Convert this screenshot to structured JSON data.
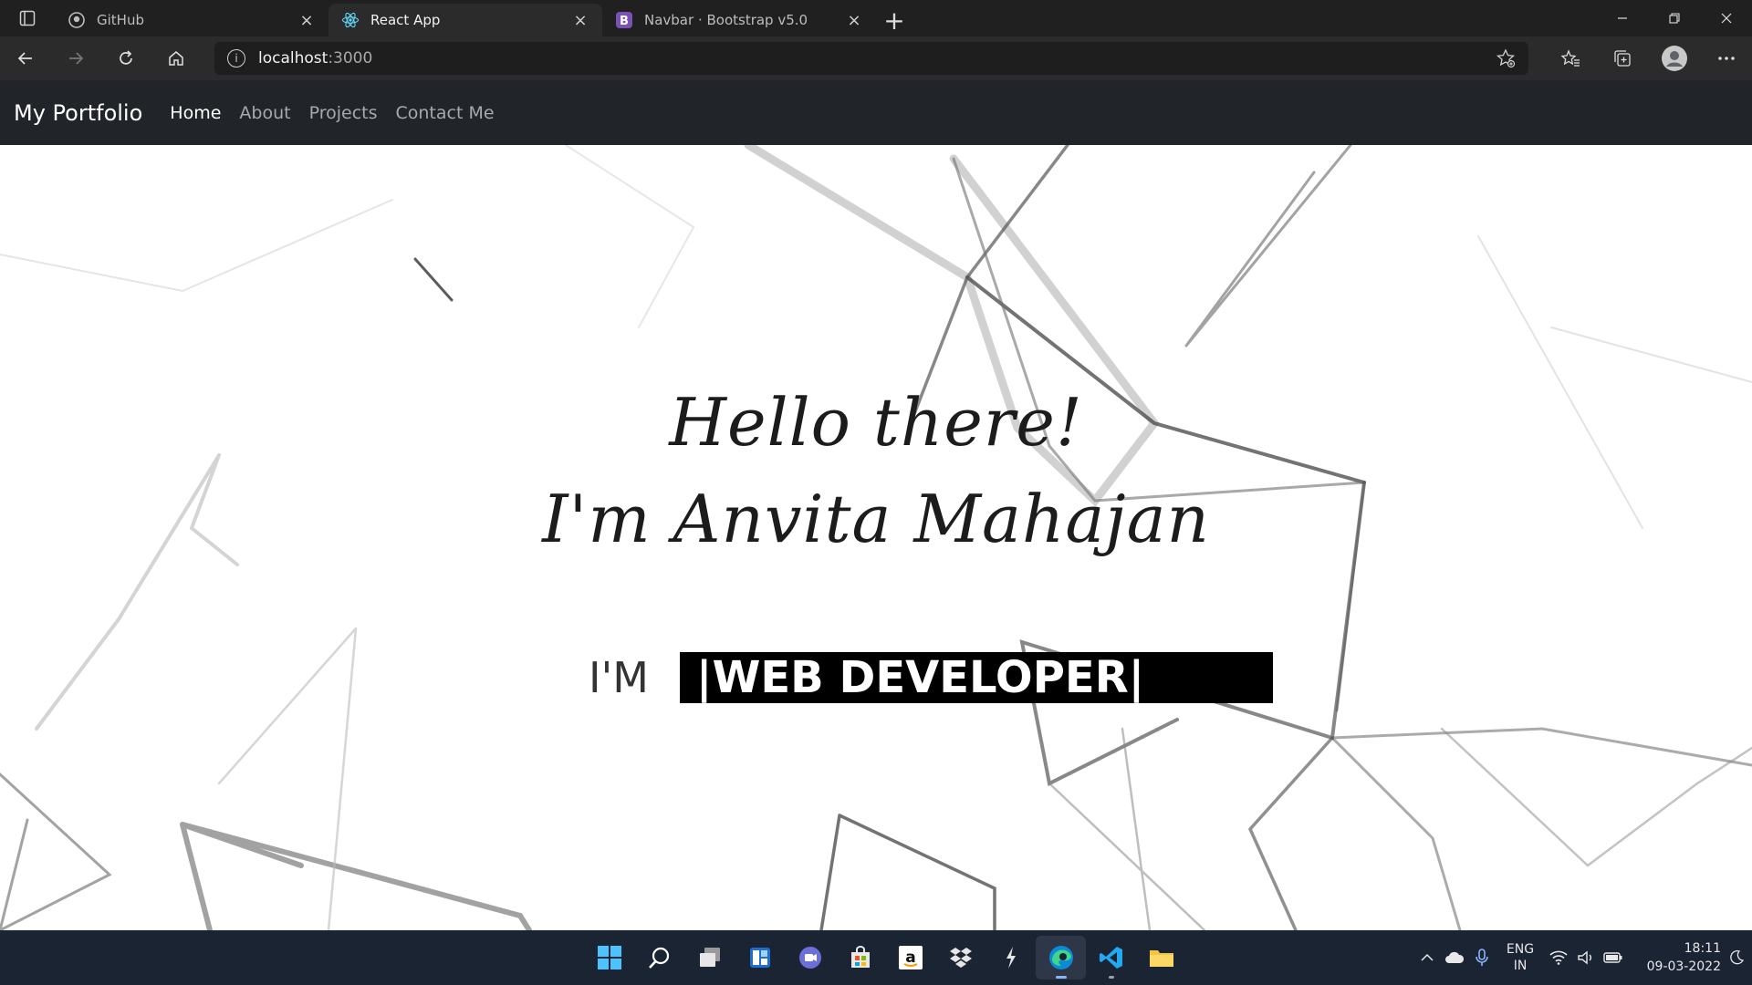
{
  "browser": {
    "tabs": [
      {
        "title": "GitHub",
        "icon": "github-icon",
        "active": false
      },
      {
        "title": "React App",
        "icon": "react-icon",
        "active": true
      },
      {
        "title": "Navbar · Bootstrap v5.0",
        "icon": "bootstrap-icon",
        "active": false
      }
    ],
    "url_host": "localhost",
    "url_port": ":3000"
  },
  "site": {
    "brand": "My Portfolio",
    "nav": [
      "Home",
      "About",
      "Projects",
      "Contact Me"
    ],
    "active_nav": "Home",
    "hero": {
      "line1": "Hello there!",
      "line2": "I'm Anvita Mahajan",
      "prefix": "I'M",
      "typed": "|WEB DEVELOPER|"
    }
  },
  "taskbar": {
    "apps": [
      "start-icon",
      "search-icon",
      "task-view-icon",
      "widgets-icon",
      "teams-chat-icon",
      "store-icon",
      "amazon-icon",
      "dropbox-icon",
      "git-kraken-icon",
      "edge-icon",
      "vscode-icon",
      "file-explorer-icon"
    ],
    "lang_line1": "ENG",
    "lang_line2": "IN",
    "time": "18:11",
    "date": "09-03-2022"
  },
  "colors": {
    "navbar_bg": "#212529",
    "taskbar_bg": "#1b2433",
    "typewriter_bg": "#000000"
  }
}
